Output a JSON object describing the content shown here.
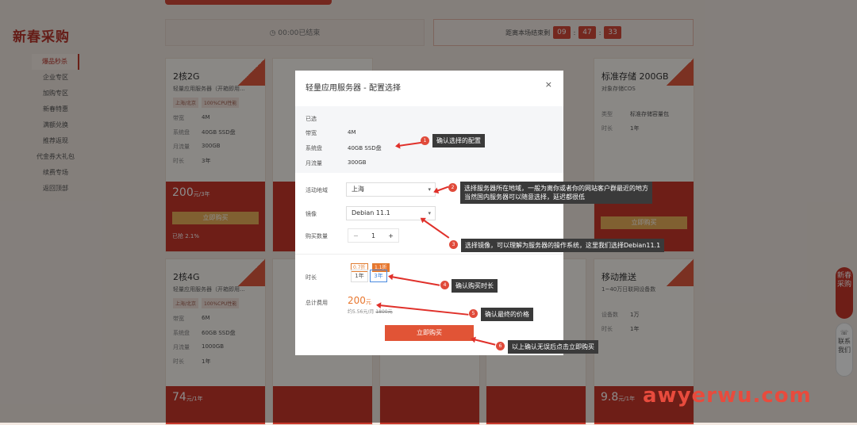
{
  "logo": "新春采购",
  "sidebar": [
    {
      "label": "爆品秒杀",
      "active": true
    },
    {
      "label": "企业专区"
    },
    {
      "label": "加购专区"
    },
    {
      "label": "新春特惠"
    },
    {
      "label": "满额兑换"
    },
    {
      "label": "推荐返现"
    },
    {
      "label": "代金券大礼包"
    },
    {
      "label": "续费专场"
    },
    {
      "label": "返回顶部"
    }
  ],
  "timer": {
    "ended": "00:00已结束",
    "label": "距离本场结束剩",
    "h": "09",
    "m": "47",
    "s": "33"
  },
  "cards": [
    {
      "title": "2核2G",
      "sub": "轻量应用服务器（开箱即用...",
      "tag1": "上海/北京",
      "tag2": "100%CPU性能",
      "bw_k": "带宽",
      "bw": "4M",
      "disk_k": "系统盘",
      "disk": "40GB SSD盘",
      "flow_k": "月流量",
      "flow": "300GB",
      "dur_k": "时长",
      "dur": "3年",
      "price": "200",
      "punit": "元/3年",
      "buy": "立即购买",
      "sold": "已抢 2.1%"
    },
    {
      "title": "2核4G",
      "sub": "轻量应用服务器（开箱即用...",
      "tag1": "上海/北京",
      "tag2": "100%CPU性能",
      "bw_k": "带宽",
      "bw": "6M",
      "disk_k": "系统盘",
      "disk": "60GB SSD盘",
      "flow_k": "月流量",
      "flow": "1000GB",
      "dur_k": "时长",
      "dur": "1年",
      "price": "74",
      "punit": "元/1年"
    }
  ],
  "card_right": {
    "title": "标准存储 200GB",
    "sub": "对象存储COS",
    "k1": "类型",
    "v1": "标准存储容量包",
    "k2": "时长",
    "v2": "1年",
    "buy": "立即购买"
  },
  "card_right2": {
    "title": "移动推送",
    "sub": "1~40万日联网设备数",
    "k1": "设备数",
    "v1": "1万",
    "k2": "时长",
    "v2": "1年",
    "price": "9.8",
    "punit": "元/1年"
  },
  "modal": {
    "title": "轻量应用服务器 - 配置选择",
    "close": "×",
    "selected": "已选",
    "bw_k": "带宽",
    "bw": "4M",
    "disk_k": "系统盘",
    "disk": "40GB SSD盘",
    "flow_k": "月流量",
    "flow": "300GB",
    "region_k": "活动地域",
    "region": "上海",
    "image_k": "镜像",
    "image": "Debian 11.1",
    "qty_k": "购买数量",
    "qty": "1",
    "minus": "−",
    "plus": "+",
    "dur_k": "时长",
    "dur1": "1年",
    "dur2": "3年",
    "tag1": "0.7折",
    "tag2": "1.1折",
    "total_k": "总计费用",
    "total": "200",
    "total_unit": "元",
    "per": "约5.56元/月",
    "orig": "1800元",
    "buy": "立即购买"
  },
  "annotations": {
    "a1": "确认选择的配置",
    "a2_line1": "选择服务器所在地域，一般为离你或者你的网站客户群最近的地方",
    "a2_line2": "当然国内服务器可以随意选择，延迟都很低",
    "a3": "选择镜像，可以理解为服务器的操作系统，这里我们选择Debian11.1",
    "a4": "确认购买时长",
    "a5": "确认最终的价格",
    "a6": "以上确认无误后点击立即购买"
  },
  "float": {
    "a": "新春采购",
    "b": "联系我们"
  },
  "watermark": "awyerwu.com"
}
